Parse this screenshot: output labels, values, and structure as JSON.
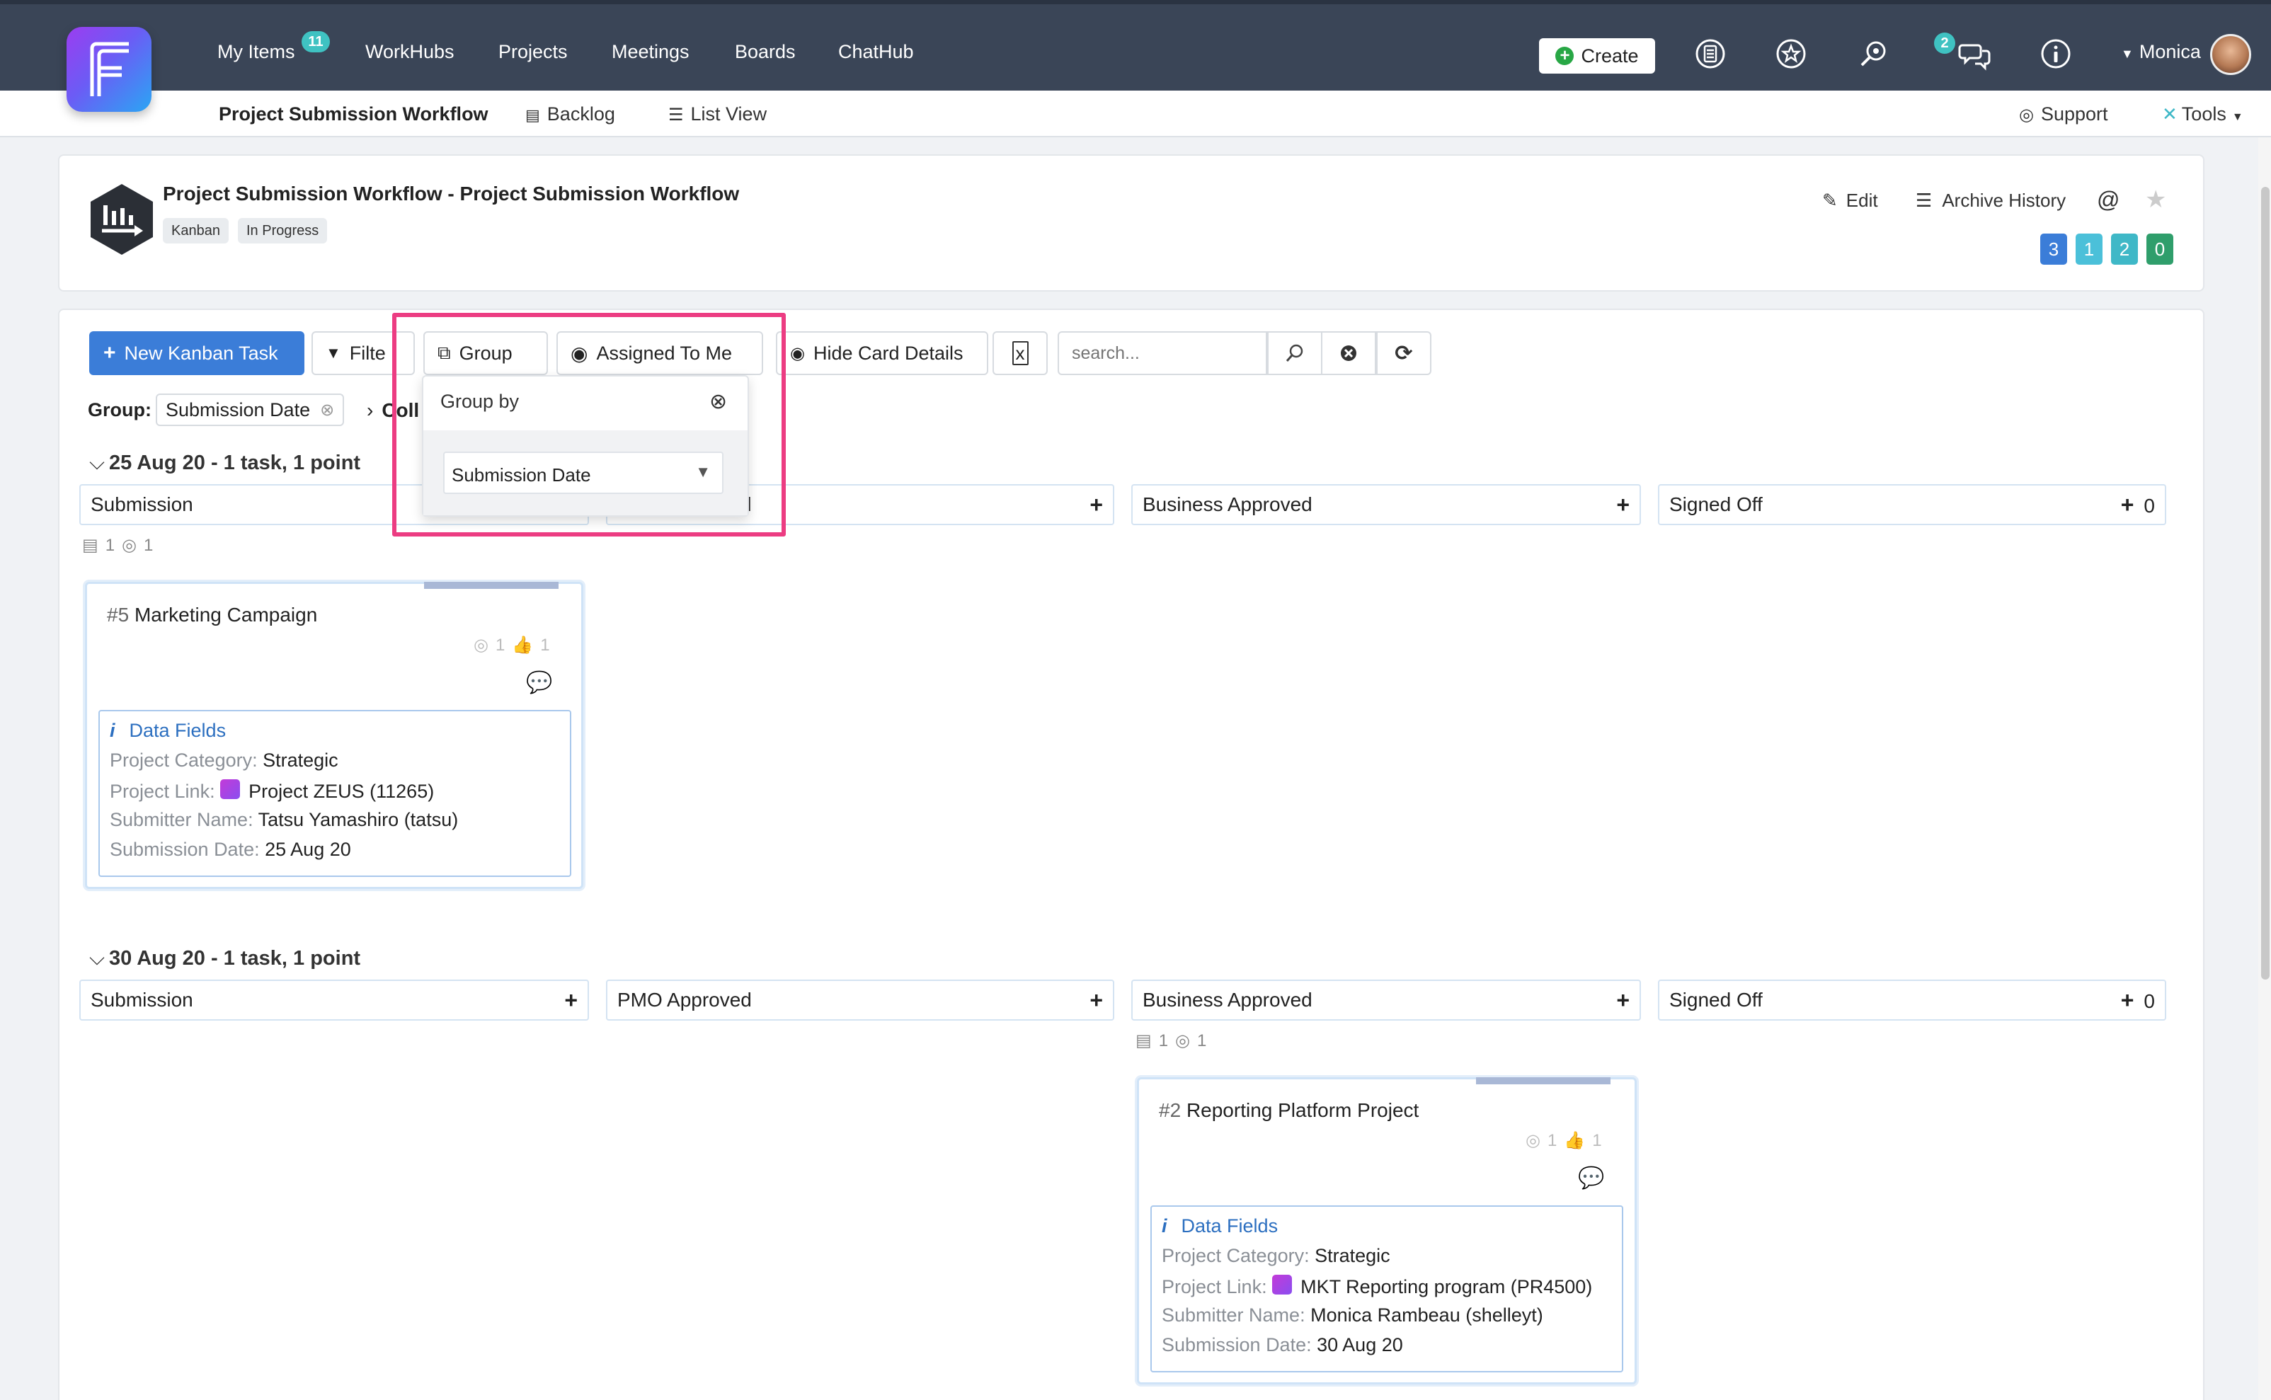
{
  "nav": {
    "items": [
      {
        "label": "My Items",
        "badge": "11"
      },
      {
        "label": "WorkHubs"
      },
      {
        "label": "Projects"
      },
      {
        "label": "Meetings"
      },
      {
        "label": "Boards"
      },
      {
        "label": "ChatHub"
      }
    ],
    "create_label": "Create",
    "chat_badge": "2",
    "user_name": "Monica"
  },
  "subnav": {
    "project": "Project Submission Workflow",
    "backlog": "Backlog",
    "list_view": "List View",
    "support": "Support",
    "tools": "Tools"
  },
  "header": {
    "title": "Project Submission Workflow - Project Submission Workflow",
    "tags": [
      "Kanban",
      "In Progress"
    ],
    "edit": "Edit",
    "archive_history": "Archive History",
    "at_symbol": "@",
    "counts": [
      {
        "value": "3",
        "color": "#3b7dd8"
      },
      {
        "value": "1",
        "color": "#4bc0d9"
      },
      {
        "value": "2",
        "color": "#3fb8c7"
      },
      {
        "value": "0",
        "color": "#2f9e6b"
      }
    ]
  },
  "toolbar": {
    "new_task": "New Kanban Task",
    "filter": "Filte",
    "group": "Group",
    "assigned": "Assigned To Me",
    "hide_details": "Hide Card Details",
    "search_placeholder": "search..."
  },
  "group_bar": {
    "label": "Group:",
    "value": "Submission Date",
    "collapse_partial": "Coll"
  },
  "dropdown": {
    "title": "Group by",
    "selected": "Submission Date"
  },
  "groups": [
    {
      "title": "25 Aug 20  - 1 task, 1 point",
      "columns": [
        {
          "name": "Submission"
        },
        {
          "name": "d"
        },
        {
          "name": "Business Approved"
        },
        {
          "name": "Signed Off",
          "count": "0"
        }
      ],
      "stats": {
        "tasks": "1",
        "points": "1"
      },
      "card": {
        "num": "#5",
        "title": "Marketing Campaign",
        "meta_points": "1",
        "meta_likes": "1",
        "fields_title": "Data Fields",
        "fields": [
          {
            "key": "Project Category:",
            "value": "Strategic"
          },
          {
            "key": "Project Link:",
            "value": "Project ZEUS (11265)"
          },
          {
            "key": "Submitter Name:",
            "value": "Tatsu Yamashiro (tatsu)"
          },
          {
            "key": "Submission Date:",
            "value": "25 Aug 20"
          }
        ]
      }
    },
    {
      "title": "30 Aug 20  - 1 task, 1 point",
      "columns": [
        {
          "name": "Submission"
        },
        {
          "name": "PMO Approved"
        },
        {
          "name": "Business Approved"
        },
        {
          "name": "Signed Off",
          "count": "0"
        }
      ],
      "stats": {
        "tasks": "1",
        "points": "1"
      },
      "card": {
        "num": "#2",
        "title": "Reporting Platform Project",
        "meta_points": "1",
        "meta_likes": "1",
        "fields_title": "Data Fields",
        "fields": [
          {
            "key": "Project Category:",
            "value": "Strategic"
          },
          {
            "key": "Project Link:",
            "value": "MKT Reporting program (PR4500)"
          },
          {
            "key": "Submitter Name:",
            "value": "Monica Rambeau (shelleyt)"
          },
          {
            "key": "Submission Date:",
            "value": "30 Aug 20"
          }
        ]
      }
    }
  ]
}
